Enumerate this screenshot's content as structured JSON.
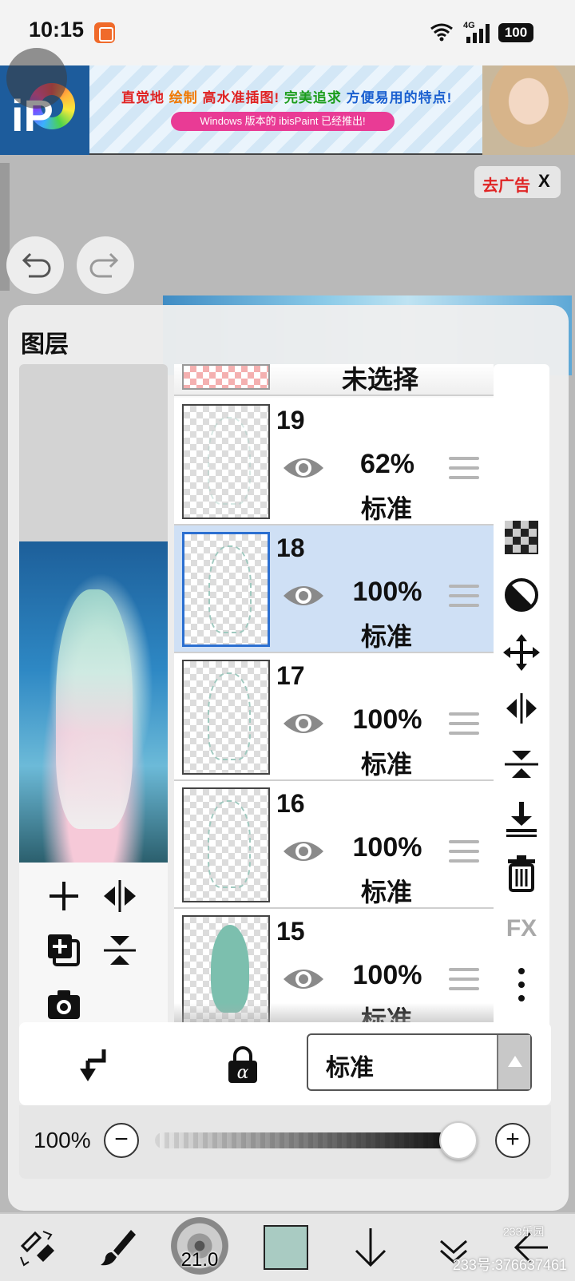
{
  "status_bar": {
    "time": "10:15",
    "network": "4G",
    "battery": "100"
  },
  "ad": {
    "logo_text": "iP",
    "title_parts": [
      "直觉地",
      "绘制",
      "高水准插图!",
      "完美追求",
      "方便易用的特点!"
    ],
    "subtitle": "Windows 版本的 ibisPaint 已经推出!",
    "remove_label": "去广告",
    "close_label": "X"
  },
  "panel": {
    "title": "图层"
  },
  "partial_layer": {
    "label": "未选择"
  },
  "layers": [
    {
      "number": "19",
      "opacity": "62%",
      "blend": "标准",
      "selected": false
    },
    {
      "number": "18",
      "opacity": "100%",
      "blend": "标准",
      "selected": true
    },
    {
      "number": "17",
      "opacity": "100%",
      "blend": "标准",
      "selected": false
    },
    {
      "number": "16",
      "opacity": "100%",
      "blend": "标准",
      "selected": false
    },
    {
      "number": "15",
      "opacity": "100%",
      "blend": "标准",
      "selected": false
    }
  ],
  "side_tools": {
    "fx_label": "FX"
  },
  "blend_mode": {
    "value": "标准"
  },
  "layer_opacity": {
    "value": "100%",
    "level": 0.95,
    "minus": "−",
    "plus": "+"
  },
  "toolbar": {
    "brush_size": "21.0",
    "color": "#a9cbc2"
  },
  "watermark": {
    "text": "233号:376637461",
    "small": "233乐园"
  }
}
